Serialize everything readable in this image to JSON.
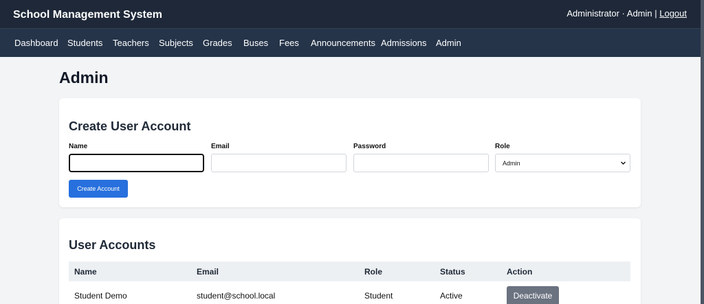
{
  "header": {
    "brand": "School Management System",
    "user_text": "Administrator · Admin | ",
    "logout_label": "Logout"
  },
  "nav": {
    "items": [
      "Dashboard",
      "Students",
      "Teachers",
      "Subjects",
      "Grades",
      "Buses",
      "Fees",
      "Announcements",
      "Admissions",
      "Admin"
    ]
  },
  "page": {
    "title": "Admin"
  },
  "create_form": {
    "title": "Create User Account",
    "name_label": "Name",
    "name_value": "",
    "email_label": "Email",
    "email_value": "",
    "password_label": "Password",
    "password_value": "",
    "role_label": "Role",
    "role_selected": "Admin",
    "submit_label": "Create Account"
  },
  "accounts": {
    "title": "User Accounts",
    "columns": [
      "Name",
      "Email",
      "Role",
      "Status",
      "Action"
    ],
    "rows": [
      {
        "name": "Student Demo",
        "email": "student@school.local",
        "role": "Student",
        "status": "Active",
        "action": "Deactivate"
      }
    ]
  },
  "colors": {
    "topbar": "#1e2838",
    "navbar": "#253449",
    "primary_button": "#2770dd",
    "secondary_button": "#6b7280"
  }
}
